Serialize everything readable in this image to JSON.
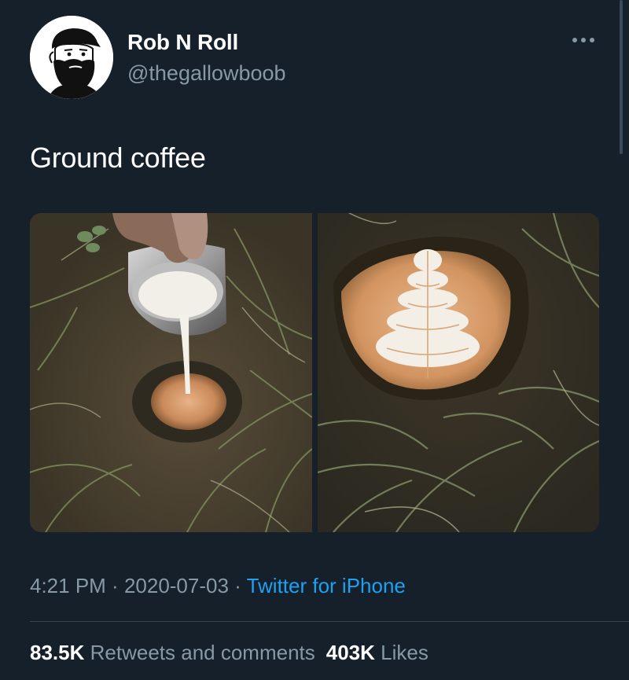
{
  "author": {
    "display_name": "Rob N Roll",
    "handle": "@thegallowboob",
    "avatar_icon": "bearded-man-cartoon-avatar"
  },
  "tweet": {
    "text": "Ground coffee"
  },
  "media": [
    {
      "description_icon": "milk-pouring-into-ground-hole-photo"
    },
    {
      "description_icon": "latte-art-in-ground-photo"
    }
  ],
  "meta": {
    "time": "4:21 PM",
    "separator": " · ",
    "date": "2020-07-03",
    "source": "Twitter for iPhone"
  },
  "stats": {
    "retweets_count": "83.5K",
    "retweets_label": "Retweets and comments",
    "likes_count": "403K",
    "likes_label": "Likes"
  },
  "icons": {
    "more": "more-options-icon"
  },
  "colors": {
    "background": "#15202b",
    "text_primary": "#ffffff",
    "text_secondary": "#8899a6",
    "link": "#1da1f2",
    "divider": "#38444d"
  }
}
